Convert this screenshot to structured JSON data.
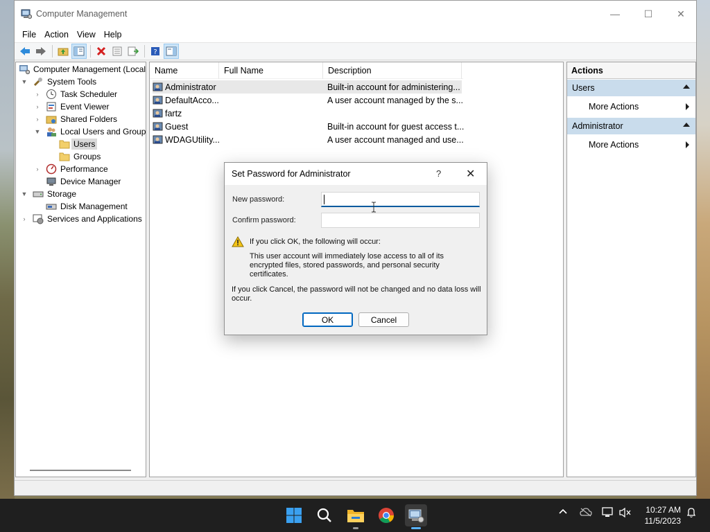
{
  "window": {
    "title": "Computer Management",
    "minimize": "—",
    "maximize": "☐",
    "close": "✕"
  },
  "menu": [
    "File",
    "Action",
    "View",
    "Help"
  ],
  "tree": {
    "root": "Computer Management (Local",
    "items": [
      {
        "label": "System Tools",
        "icon": "tools-icon"
      },
      {
        "label": "Task Scheduler",
        "icon": "clock-icon"
      },
      {
        "label": "Event Viewer",
        "icon": "event-viewer-icon"
      },
      {
        "label": "Shared Folders",
        "icon": "shared-folders-icon"
      },
      {
        "label": "Local Users and Groups",
        "icon": "users-groups-icon"
      },
      {
        "label": "Users",
        "icon": "folder-icon"
      },
      {
        "label": "Groups",
        "icon": "folder-icon"
      },
      {
        "label": "Performance",
        "icon": "performance-icon"
      },
      {
        "label": "Device Manager",
        "icon": "device-manager-icon"
      },
      {
        "label": "Storage",
        "icon": "storage-icon"
      },
      {
        "label": "Disk Management",
        "icon": "disk-icon"
      },
      {
        "label": "Services and Applications",
        "icon": "services-icon"
      }
    ]
  },
  "list": {
    "columns": [
      "Name",
      "Full Name",
      "Description"
    ],
    "rows": [
      {
        "name": "Administrator",
        "full_name": "",
        "description": "Built-in account for administering..."
      },
      {
        "name": "DefaultAcco...",
        "full_name": "",
        "description": "A user account managed by the s..."
      },
      {
        "name": "fartz",
        "full_name": "",
        "description": ""
      },
      {
        "name": "Guest",
        "full_name": "",
        "description": "Built-in account for guest access t..."
      },
      {
        "name": "WDAGUtility...",
        "full_name": "",
        "description": "A user account managed and use..."
      }
    ]
  },
  "actions": {
    "header": "Actions",
    "sections": [
      {
        "title": "Users",
        "item": "More Actions"
      },
      {
        "title": "Administrator",
        "item": "More Actions"
      }
    ]
  },
  "dialog": {
    "title": "Set Password for Administrator",
    "help": "?",
    "close": "✕",
    "new_password_label": "New password:",
    "new_password_value": "",
    "confirm_password_label": "Confirm password:",
    "confirm_password_value": "",
    "warning_heading": "If you click OK, the following will occur:",
    "warning_body": "This user account will immediately lose access to all of its encrypted files, stored passwords, and personal security certificates.",
    "cancel_note": "If you click Cancel, the password will not be changed and no data loss will occur.",
    "ok_label": "OK",
    "cancel_label": "Cancel"
  },
  "taskbar": {
    "time": "10:27 AM",
    "date": "11/5/2023"
  },
  "colors": {
    "accent": "#0067c0",
    "actions_section": "#c9dcec",
    "taskbar": "#1f1f1f"
  }
}
